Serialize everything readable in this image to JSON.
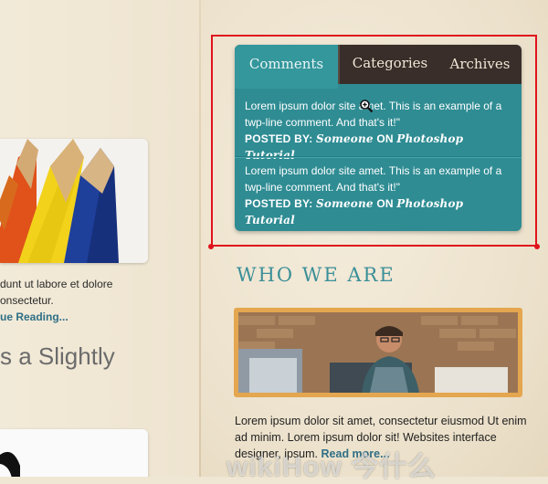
{
  "left": {
    "snippet_line1": "dunt ut labore et dolore",
    "snippet_line2": "onsectetur.",
    "continue_link": "ue Reading...",
    "heading_partial": "s a Slightly"
  },
  "tabs": {
    "items": [
      "Comments",
      "Categories",
      "Archives"
    ],
    "active": "Comments"
  },
  "comments": [
    {
      "text": "Lorem ipsum dolor site amet. This is an example of a twp-line comment. And that's it!\"",
      "posted_by_label": "POSTED BY:",
      "author": "Someone",
      "on_label": "ON",
      "post": "Photoshop Tutorial"
    },
    {
      "text": "Lorem ipsum dolor site amet. This is an example of a twp-line comment. And that's it!\"",
      "posted_by_label": "POSTED BY:",
      "author": "Someone",
      "on_label": "ON",
      "post": "Photoshop Tutorial"
    }
  ],
  "who": {
    "heading": "WHO WE ARE",
    "text": "Lorem ipsum dolor sit amet, consectetur eiusmod Ut enim ad minim. Lorem ipsum dolor sit! Websites interface designer, ipsum.",
    "read_more": "Read more..."
  },
  "watermark": "wikiHow 今什么",
  "colors": {
    "teal": "#2f8c93",
    "tab_dark": "#3a2e2a",
    "highlight": "#e0141c",
    "heading_teal": "#3b8f98"
  },
  "icons": [
    "zoom-cursor-icon"
  ]
}
